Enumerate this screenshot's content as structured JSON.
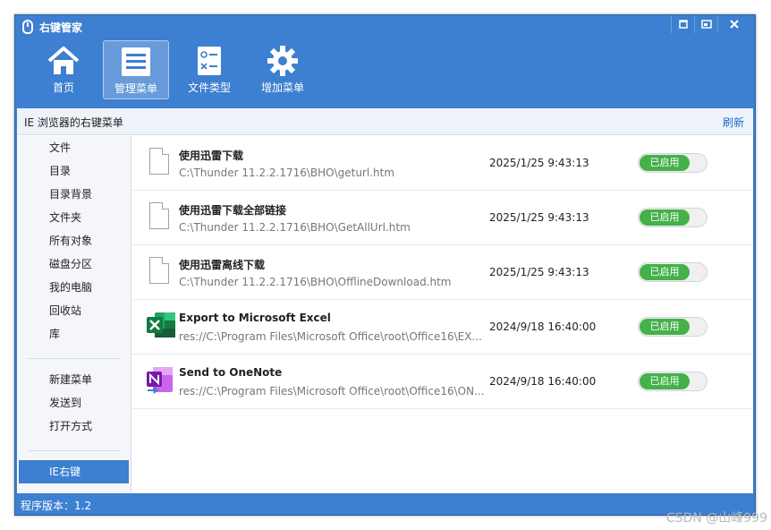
{
  "window": {
    "title": "右键管家",
    "buttons": {
      "minimize": "▫",
      "restore": "⧉",
      "close": "✕"
    }
  },
  "toolbar": {
    "items": [
      {
        "label": "首页",
        "icon": "home-icon"
      },
      {
        "label": "管理菜单",
        "icon": "menu-list-icon"
      },
      {
        "label": "文件类型",
        "icon": "file-type-icon"
      },
      {
        "label": "增加菜单",
        "icon": "gear-icon"
      }
    ],
    "active_index": 1
  },
  "subheader": {
    "title": "IE 浏览器的右键菜单",
    "refresh": "刷新"
  },
  "sidebar": {
    "group1": [
      "文件",
      "目录",
      "目录背景",
      "文件夹",
      "所有对象",
      "磁盘分区",
      "我的电脑",
      "回收站",
      "库"
    ],
    "group2": [
      "新建菜单",
      "发送到",
      "打开方式"
    ],
    "active": "IE右键"
  },
  "rows": [
    {
      "title": "使用迅雷下载",
      "path": "C:\\Thunder 11.2.2.1716\\BHO\\geturl.htm",
      "date": "2025/1/25 9:43:13",
      "status": "已启用",
      "icon": "file-icon"
    },
    {
      "title": "使用迅雷下载全部链接",
      "path": "C:\\Thunder 11.2.2.1716\\BHO\\GetAllUrl.htm",
      "date": "2025/1/25 9:43:13",
      "status": "已启用",
      "icon": "file-icon"
    },
    {
      "title": "使用迅雷离线下载",
      "path": "C:\\Thunder 11.2.2.1716\\BHO\\OfflineDownload.htm",
      "date": "2025/1/25 9:43:13",
      "status": "已启用",
      "icon": "file-icon"
    },
    {
      "title": "Export to Microsoft Excel",
      "path": "res://C:\\Program Files\\Microsoft Office\\root\\Office16\\EX...",
      "date": "2024/9/18 16:40:00",
      "status": "已启用",
      "icon": "excel-icon"
    },
    {
      "title": "Send to OneNote",
      "path": "res://C:\\Program Files\\Microsoft Office\\root\\Office16\\ON...",
      "date": "2024/9/18 16:40:00",
      "status": "已启用",
      "icon": "onenote-icon"
    }
  ],
  "statusbar": {
    "version": "程序版本：1.2"
  },
  "watermark": "CSDN @山峰999",
  "colors": {
    "accent": "#3d7fd0",
    "enabled": "#44b14a",
    "link": "#1e6cc8"
  }
}
